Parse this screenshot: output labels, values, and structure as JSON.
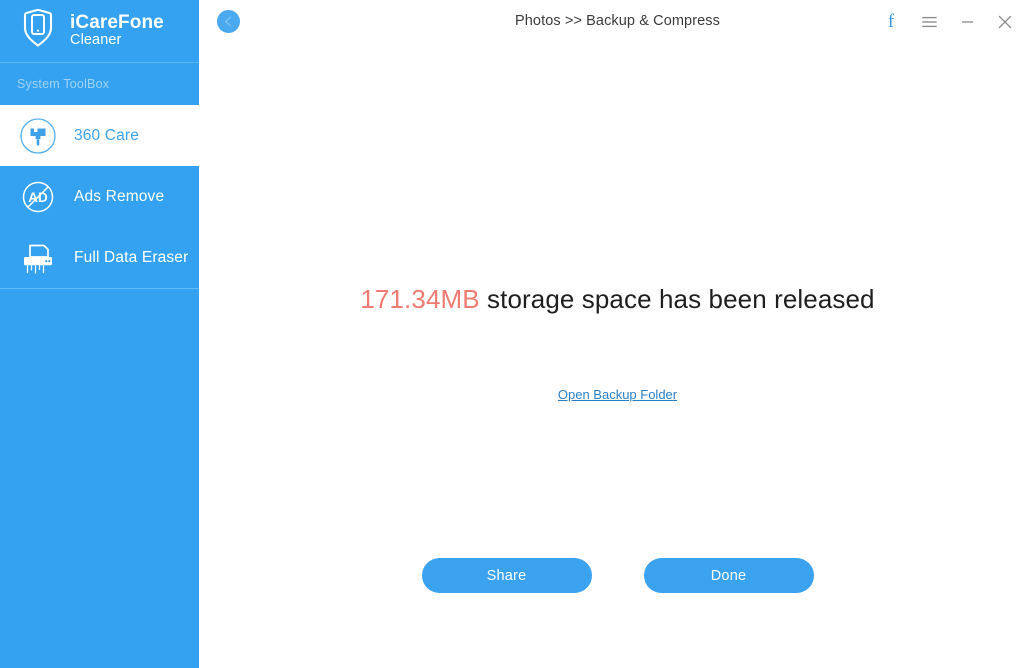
{
  "sidebar": {
    "brand": {
      "logo_icon": "phone-shield-logo-icon",
      "name": "iCareFone",
      "subtitle": "Cleaner"
    },
    "section_label": "System ToolBox",
    "items": [
      {
        "label": "360 Care",
        "icon": "paint-brush-circle-icon",
        "active": true
      },
      {
        "label": "Ads Remove",
        "icon": "ad-block-icon",
        "active": false
      },
      {
        "label": "Full Data Eraser",
        "icon": "paper-shredder-icon",
        "active": false
      }
    ],
    "background_color": "#34a2f0",
    "active_text_color": "#3fa2e8"
  },
  "titlebar": {
    "back_icon": "back-chevron-icon",
    "title": "Photos >> Backup & Compress",
    "controls": [
      {
        "name": "facebook-share",
        "icon": "facebook-icon",
        "glyph": "f"
      },
      {
        "name": "menu",
        "icon": "hamburger-menu-icon",
        "glyph": "☰"
      },
      {
        "name": "minimize",
        "icon": "minimize-icon",
        "glyph": "–"
      },
      {
        "name": "close",
        "icon": "close-icon",
        "glyph": "✕"
      }
    ]
  },
  "content": {
    "released_amount": "171.34MB",
    "released_message": " storage space has been released",
    "amount_color": "#ef7b72",
    "backup_link_label": "Open Backup Folder",
    "backup_link_color": "#2b7fc4",
    "buttons": {
      "share_label": "Share",
      "done_label": "Done",
      "accent_color": "#3ba2ef"
    }
  }
}
